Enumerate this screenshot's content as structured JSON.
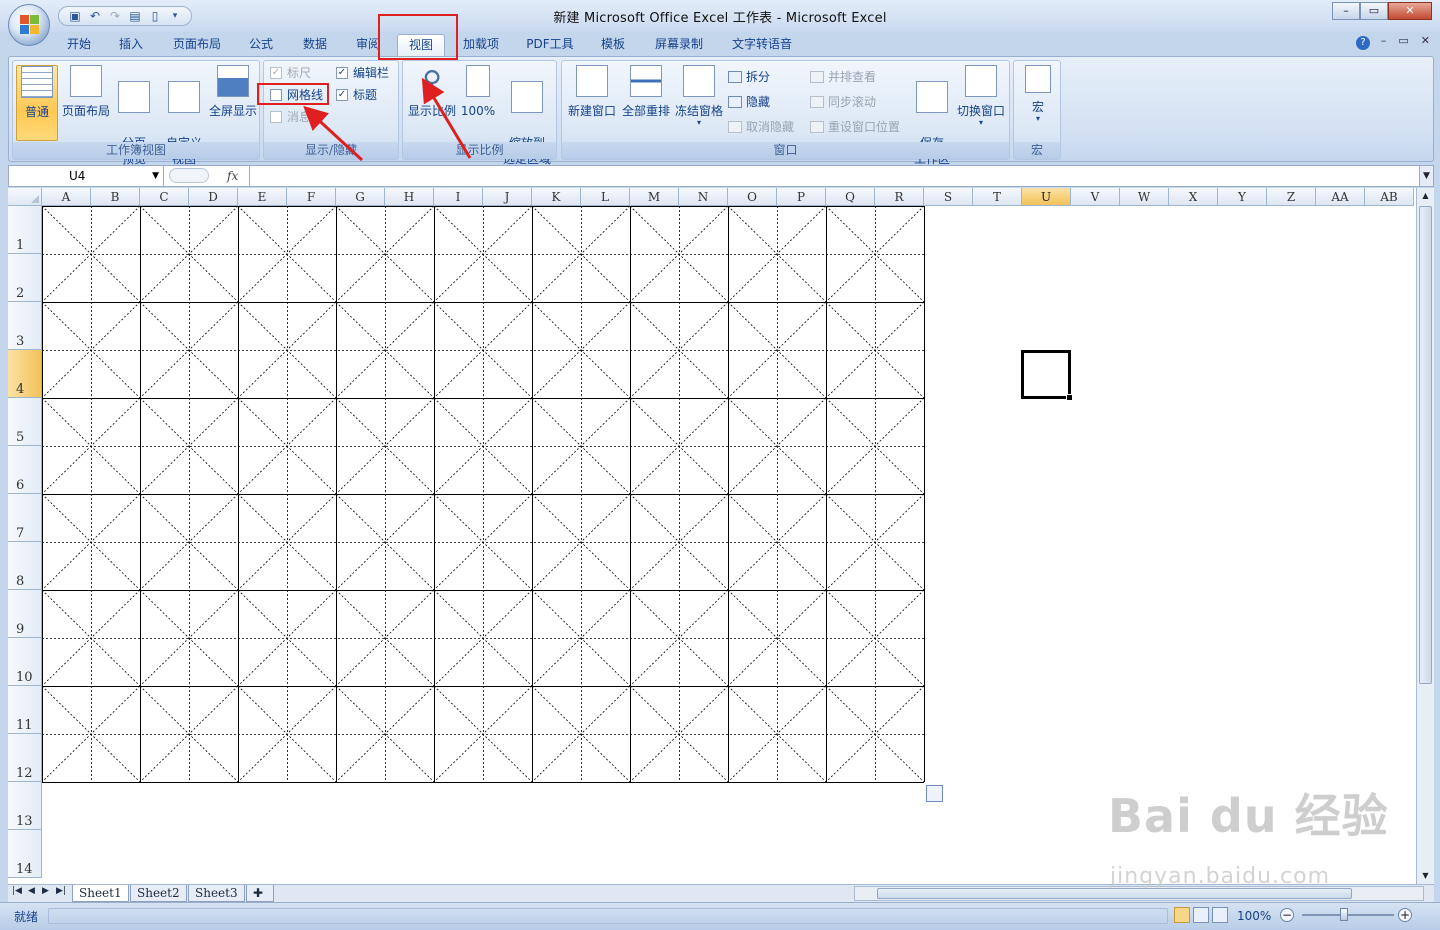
{
  "window": {
    "title": "新建 Microsoft Office Excel 工作表 - Microsoft Excel",
    "controls": [
      "–",
      "▭",
      "✕"
    ]
  },
  "qat_icons": [
    "save-icon",
    "undo-icon",
    "redo-icon",
    "form-icon",
    "new-icon",
    "customize-icon"
  ],
  "tabs": [
    {
      "label": "开始"
    },
    {
      "label": "插入"
    },
    {
      "label": "页面布局"
    },
    {
      "label": "公式"
    },
    {
      "label": "数据"
    },
    {
      "label": "审阅"
    },
    {
      "label": "视图",
      "active": true
    },
    {
      "label": "加载项"
    },
    {
      "label": "PDF工具"
    },
    {
      "label": "模板"
    },
    {
      "label": "屏幕录制"
    },
    {
      "label": "文字转语音"
    }
  ],
  "ribbon": {
    "workbook_views": {
      "label": "工作簿视图",
      "buttons": [
        "普通",
        "页面布局",
        "分页\n预览",
        "自定义\n视图",
        "全屏显示"
      ]
    },
    "show_hide": {
      "label": "显示/隐藏",
      "ruler": {
        "label": "标尺",
        "checked": true,
        "enabled": false
      },
      "gridlines": {
        "label": "网格线",
        "checked": false,
        "enabled": true
      },
      "message_bar": {
        "label": "消息栏",
        "checked": false,
        "enabled": false
      },
      "formula_bar": {
        "label": "编辑栏",
        "checked": true,
        "enabled": true
      },
      "headings": {
        "label": "标题",
        "checked": true,
        "enabled": true
      }
    },
    "zoom": {
      "label": "显示比例",
      "buttons": [
        "显示比例",
        "100%",
        "缩放到\n选定区域"
      ]
    },
    "window": {
      "label": "窗口",
      "big_buttons": [
        "新建窗口",
        "全部重排",
        "冻结窗格"
      ],
      "small_buttons": [
        {
          "label": "拆分",
          "enabled": true
        },
        {
          "label": "隐藏",
          "enabled": true
        },
        {
          "label": "取消隐藏",
          "enabled": false
        },
        {
          "label": "并排查看",
          "enabled": false
        },
        {
          "label": "同步滚动",
          "enabled": false
        },
        {
          "label": "重设窗口位置",
          "enabled": false
        }
      ],
      "save_workspace": "保存\n工作区",
      "switch_windows": "切换窗口"
    },
    "macros": {
      "label": "宏",
      "button": "宏"
    }
  },
  "formula_bar": {
    "name_box": "U4",
    "fx": "fx",
    "value": ""
  },
  "columns": [
    "A",
    "B",
    "C",
    "D",
    "E",
    "F",
    "G",
    "H",
    "I",
    "J",
    "K",
    "L",
    "M",
    "N",
    "O",
    "P",
    "Q",
    "R",
    "S",
    "T",
    "U",
    "V",
    "W",
    "X",
    "Y",
    "Z",
    "AA",
    "AB"
  ],
  "selected_column": "U",
  "rows": [
    "1",
    "2",
    "3",
    "4",
    "5",
    "6",
    "7",
    "8",
    "9",
    "10",
    "11",
    "12",
    "13",
    "14"
  ],
  "selected_row": "4",
  "grid": {
    "pattern_columns": 18,
    "pattern_rows": 12
  },
  "sheet_tabs": [
    {
      "label": "Sheet1",
      "active": true
    },
    {
      "label": "Sheet2"
    },
    {
      "label": "Sheet3"
    }
  ],
  "status": {
    "text": "就绪",
    "zoom": "100%",
    "zoom_level_percent": 100
  },
  "watermark": {
    "brand": "Bai du 经验",
    "url": "jingyan.baidu.com"
  },
  "colors": {
    "annotation": "#e02020",
    "selection": "#f2c25a"
  }
}
